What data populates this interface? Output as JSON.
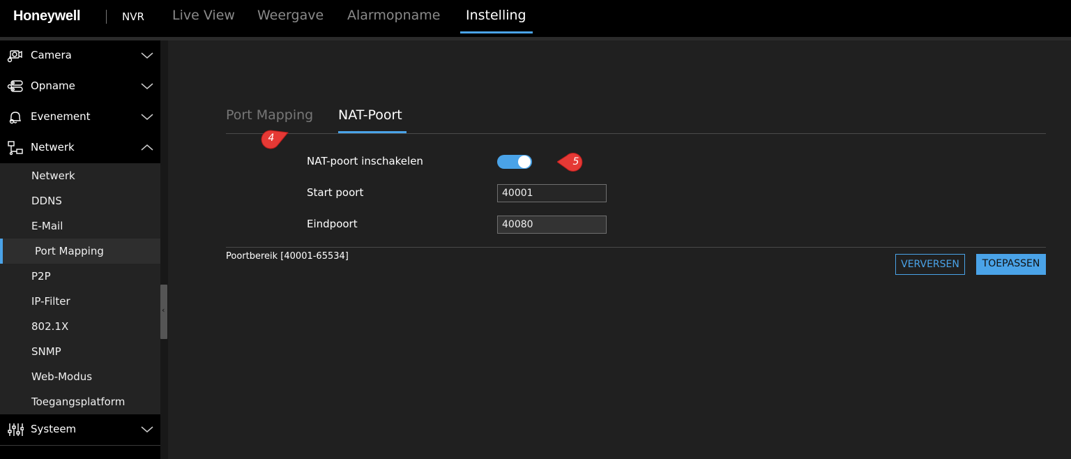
{
  "brand": {
    "logo": "Honeywell",
    "product": "NVR"
  },
  "top_nav": {
    "items": [
      "Live View",
      "Weergave",
      "Alarmopname",
      "Instelling"
    ],
    "active": "Instelling"
  },
  "sidebar": {
    "groups": {
      "camera": "Camera",
      "opname": "Opname",
      "evenement": "Evenement",
      "netwerk": "Netwerk",
      "systeem": "Systeem"
    },
    "netwerk_items": [
      "Netwerk",
      "DDNS",
      "E-Mail",
      "Port Mapping",
      "P2P",
      "IP-Filter",
      "802.1X",
      "SNMP",
      "Web-Modus",
      "Toegangsplatform"
    ],
    "active_item": "Port Mapping"
  },
  "tabs": [
    "Port Mapping",
    "NAT-Poort"
  ],
  "active_tab": "NAT-Poort",
  "form": {
    "enable_label": "NAT-poort inschakelen",
    "enable_value": true,
    "start_label": "Start poort",
    "start_value": "40001",
    "end_label": "Eindpoort",
    "end_value": "40080"
  },
  "range_note": "Poortbereik [40001-65534]",
  "buttons": {
    "refresh": "VERVERSEN",
    "apply": "TOEPASSEN"
  },
  "callouts": [
    "4",
    "5"
  ],
  "colors": {
    "accent": "#4aa3e8",
    "callout": "#e53935"
  }
}
